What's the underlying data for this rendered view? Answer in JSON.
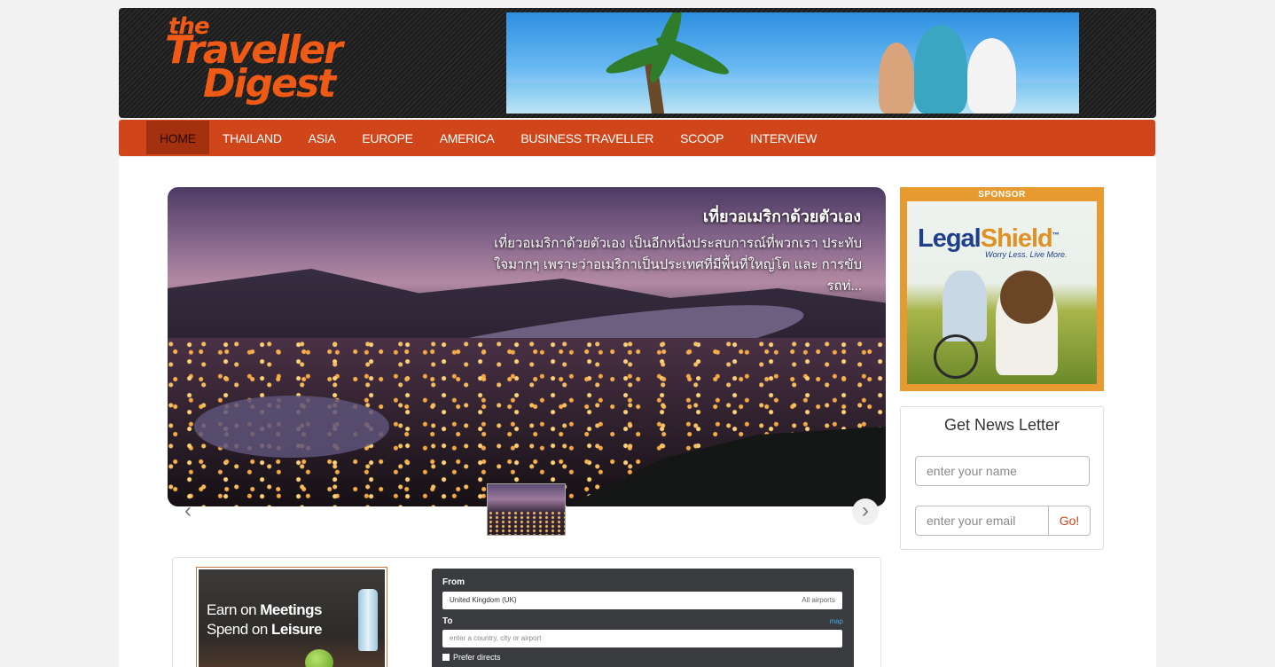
{
  "site": {
    "logo_line1": "the",
    "logo_line2": "Traveller",
    "logo_line3": "Digest"
  },
  "nav": {
    "items": [
      {
        "label": "HOME",
        "active": true
      },
      {
        "label": "THAILAND"
      },
      {
        "label": "ASIA"
      },
      {
        "label": "EUROPE"
      },
      {
        "label": "AMERICA"
      },
      {
        "label": "BUSINESS TRAVELLER"
      },
      {
        "label": "SCOOP"
      },
      {
        "label": "INTERVIEW"
      }
    ]
  },
  "slider": {
    "title": "เที่ยวอเมริกาด้วยตัวเอง",
    "excerpt": "เที่ยวอเมริกาด้วยตัวเอง เป็นอีกหนึ่งประสบการณ์ที่พวกเรา ประทับใจมากๆ เพราะว่าอเมริกาเป็นประเทศที่มีพื้นที่ใหญ่โต และ การขับรถท่...",
    "prev_icon": "chevron-left-icon",
    "next_icon": "chevron-right-icon"
  },
  "promo": {
    "line1_a": "Earn on ",
    "line1_b": "Meetings",
    "line2_a": "Spend on ",
    "line2_b": "Leisure"
  },
  "flight_search": {
    "from_label": "From",
    "from_value": "United Kingdom (UK)",
    "from_right": "All airports",
    "to_label": "To",
    "map_link": "map",
    "to_placeholder": "enter a country, city or airport",
    "prefer_directs": "Prefer directs"
  },
  "sponsor": {
    "tag": "SPONSOR",
    "brand_a": "Legal",
    "brand_b": "Shield",
    "tm": "™",
    "tagline": "Worry Less. Live More."
  },
  "newsletter": {
    "title": "Get News Letter",
    "name_placeholder": "enter your name",
    "email_placeholder": "enter your email",
    "submit_label": "Go!"
  },
  "colors": {
    "nav_bg": "#d0461a",
    "nav_active": "#a3300f",
    "logo": "#ef5b16",
    "sponsor_frame": "#e69a2f"
  }
}
